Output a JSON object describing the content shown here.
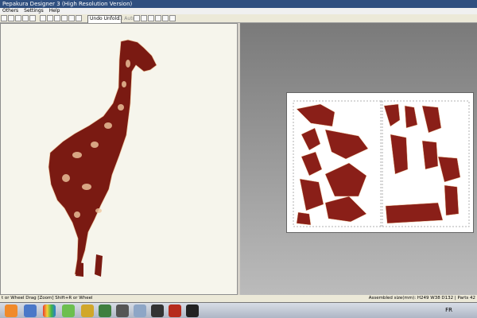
{
  "window": {
    "title": "Pepakura Designer 3 (High Resolution Version)",
    "menus": [
      "Others",
      "Settings",
      "Help"
    ]
  },
  "toolbar": {
    "undo_unfold": "Undo Unfold",
    "auto": "Auto"
  },
  "status": {
    "left": "t or Wheel Drag [Zoom] Shift+R or Wheel",
    "right": "Assembled size(mm): H249 W38 D132 | Parts 42"
  },
  "taskbar": {
    "language": "FR",
    "icons": [
      "firefox-icon",
      "network-icon",
      "color-icon",
      "palette-icon",
      "crown-icon",
      "dragon-icon",
      "game-icon",
      "gear-icon",
      "folder-icon",
      "tool-icon",
      "filezilla-icon",
      "clapper-icon"
    ]
  },
  "colors": {
    "title_bar": "#2f4f7f",
    "viewport_bg": "#f6f5ec",
    "giraffe_red": "#7a1a12",
    "giraffe_cream": "#f0c8a0",
    "sheet_bg": "#ffffff"
  }
}
